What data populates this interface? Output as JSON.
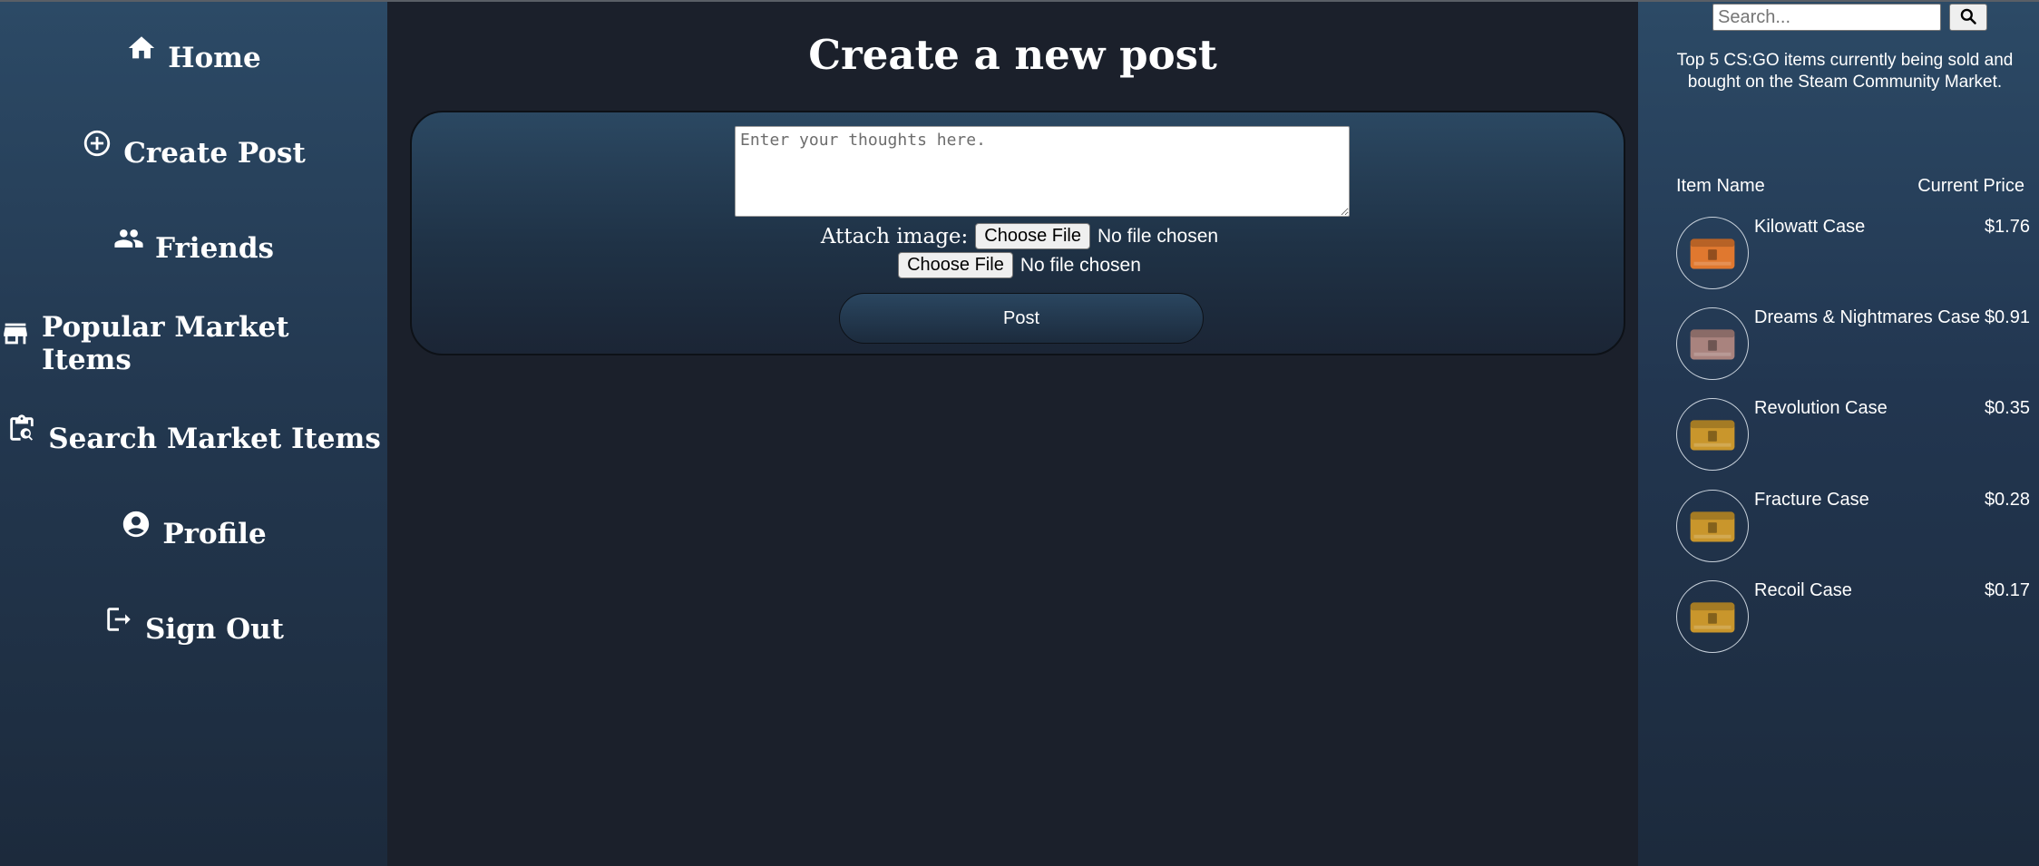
{
  "sidebar": {
    "items": [
      {
        "label": "Home",
        "icon": "home-icon"
      },
      {
        "label": "Create Post",
        "icon": "add-circle-icon"
      },
      {
        "label": "Friends",
        "icon": "people-icon"
      },
      {
        "label": "Popular Market Items",
        "icon": "storefront-icon"
      },
      {
        "label": "Search Market Items",
        "icon": "clipboard-search-icon"
      },
      {
        "label": "Profile",
        "icon": "account-circle-icon"
      },
      {
        "label": "Sign Out",
        "icon": "logout-icon"
      }
    ]
  },
  "main": {
    "title": "Create a new post",
    "textarea_placeholder": "Enter your thoughts here.",
    "attach_label": "Attach image:",
    "file_button": "Choose File",
    "file_status": "No file chosen",
    "post_button": "Post"
  },
  "right": {
    "search_placeholder": "Search...",
    "search_icon": "magnifier-icon",
    "description": "Top 5 CS:GO items currently being sold and bought on the Steam Community Market.",
    "col_name": "Item Name",
    "col_price": "Current Price",
    "items": [
      {
        "name": "Kilowatt Case",
        "price": "$1.76",
        "color": "#e0782f"
      },
      {
        "name": "Dreams & Nightmares Case",
        "price": "$0.91",
        "color": "#a9837e"
      },
      {
        "name": "Revolution Case",
        "price": "$0.35",
        "color": "#c9962c"
      },
      {
        "name": "Fracture Case",
        "price": "$0.28",
        "color": "#c9962c"
      },
      {
        "name": "Recoil Case",
        "price": "$0.17",
        "color": "#c9962c"
      }
    ]
  }
}
